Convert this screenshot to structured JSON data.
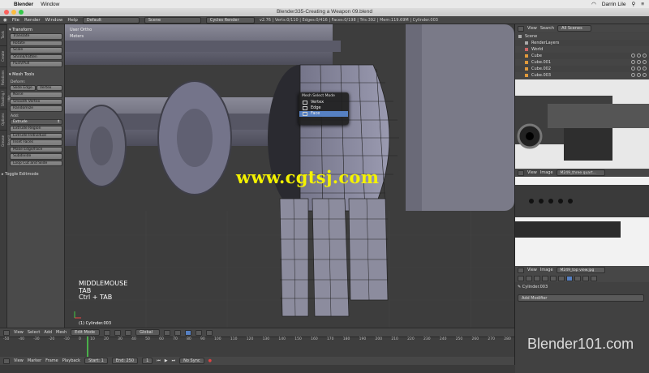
{
  "mac": {
    "app": "Blender",
    "menu": [
      "Window"
    ],
    "user": "Darrin Lile",
    "time": "",
    "battery": ""
  },
  "window_title": "Blender335-Creating a Weapon 09.blend",
  "info": {
    "menus": [
      "File",
      "Render",
      "Window",
      "Help"
    ],
    "layout": "Default",
    "scene": "Scene",
    "engine": "Cycles Render",
    "stats": "v2.76 | Verts:0/110 | Edges:0/416 | Faces:0/198 | Tris:392 | Mem:119.69M | Cylinder.003"
  },
  "tabs": [
    "Tools",
    "Create",
    "Relations",
    "Shading / UVs",
    "Options",
    "Grease Pencil"
  ],
  "tools": {
    "transform_header": "Transform",
    "transform": [
      "Translate",
      "Rotate",
      "Scale",
      "Shrink/Fatten",
      "Push/Pull"
    ],
    "mesh_tools_header": "Mesh Tools",
    "deform_label": "Deform:",
    "deform_row": [
      "Slide Edge",
      "Vertex"
    ],
    "deform": [
      "Noise",
      "Smooth Vertex",
      "Randomize"
    ],
    "add_label": "Add:",
    "extrude_select": "Extrude",
    "add": [
      "Extrude Region",
      "Extrude Individual",
      "Inset Faces",
      "Make Edge/Face",
      "Subdivide",
      "Loop Cut and Slide"
    ],
    "toggle": "Toggle Editmode"
  },
  "viewport": {
    "view_name": "User Ortho",
    "units": "Meters",
    "keyhint": [
      "MIDDLEMOUSE",
      "TAB",
      "Ctrl + TAB"
    ],
    "object": "(1) Cylinder.003",
    "watermark": "www.cgtsj.com"
  },
  "popup": {
    "title": "Mesh Select Mode",
    "items": [
      "Vertex",
      "Edge",
      "Face"
    ],
    "active": 2
  },
  "vheader": {
    "menus": [
      "View",
      "Select",
      "Add",
      "Mesh"
    ],
    "mode": "Edit Mode",
    "orientation": "Global"
  },
  "timeline": {
    "ruler": [
      "-50",
      "-40",
      "-30",
      "-20",
      "-10",
      "0",
      "10",
      "20",
      "30",
      "40",
      "50",
      "60",
      "70",
      "80",
      "90",
      "100",
      "110",
      "120",
      "130",
      "140",
      "150",
      "160",
      "170",
      "180",
      "190",
      "200",
      "210",
      "220",
      "230",
      "240",
      "250",
      "260",
      "270",
      "280"
    ],
    "menus": [
      "View",
      "Marker",
      "Frame",
      "Playback"
    ],
    "start_label": "Start:",
    "start": "1",
    "end_label": "End:",
    "end": "250",
    "current": "1",
    "sync": "No Sync"
  },
  "outliner": {
    "menus": [
      "View",
      "Search"
    ],
    "filter": "All Scenes",
    "rows": [
      "Scene",
      "RenderLayers",
      "World",
      "Cube",
      "Cube.001",
      "Cube.002",
      "Cube.003"
    ]
  },
  "image1": {
    "menus": [
      "View",
      "Image"
    ],
    "name": "M249_three quart..."
  },
  "image2": {
    "menus": [
      "View",
      "Image"
    ],
    "name": "M249_top view.jpg"
  },
  "properties": {
    "object": "Cylinder.003",
    "add_modifier": "Add Modifier"
  },
  "brand": "Blender101.com"
}
